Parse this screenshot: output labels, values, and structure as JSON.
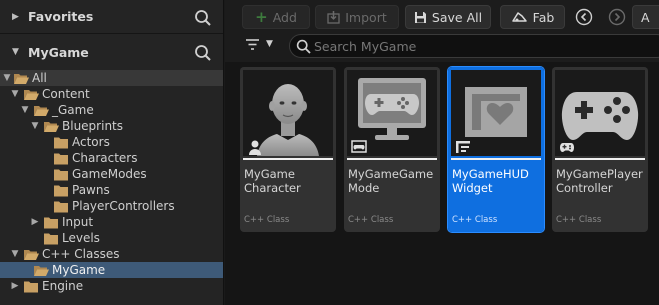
{
  "left": {
    "favorites_label": "Favorites",
    "project_label": "MyGame",
    "tree": [
      {
        "label": "All"
      },
      {
        "label": "Content"
      },
      {
        "label": "_Game"
      },
      {
        "label": "Blueprints"
      },
      {
        "label": "Actors"
      },
      {
        "label": "Characters"
      },
      {
        "label": "GameModes"
      },
      {
        "label": "Pawns"
      },
      {
        "label": "PlayerControllers"
      },
      {
        "label": "Input"
      },
      {
        "label": "Levels"
      },
      {
        "label": "C++ Classes"
      },
      {
        "label": "MyGame"
      },
      {
        "label": "Engine"
      }
    ]
  },
  "toolbar": {
    "add_label": "Add",
    "import_label": "Import",
    "save_all_label": "Save All",
    "fab_label": "Fab",
    "settings_label": "A"
  },
  "search": {
    "placeholder": "Search MyGame"
  },
  "tiles": [
    {
      "name": "MyGame\nCharacter",
      "type": "C++ Class"
    },
    {
      "name": "MyGameGame\nMode",
      "type": "C++ Class"
    },
    {
      "name": "MyGameHUD\nWidget",
      "type": "C++ Class"
    },
    {
      "name": "MyGamePlayer\nController",
      "type": "C++ Class"
    }
  ],
  "colors": {
    "accent": "#0f6fe0",
    "folder": "#c8a064",
    "add_plus": "#4caf50"
  }
}
